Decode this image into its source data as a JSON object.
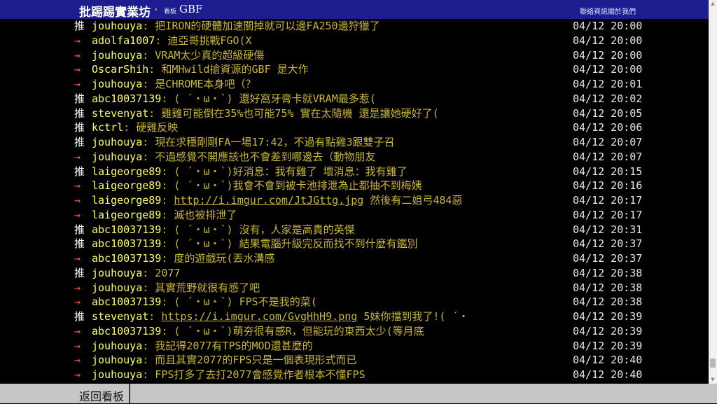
{
  "topbar": {
    "board_title": "批踢踢實業坊",
    "chevron": "›",
    "board_label": "看板",
    "board_name": "GBF",
    "links": [
      "聯絡資訊",
      "關於我們"
    ]
  },
  "comments": [
    {
      "tag": "推",
      "type": "push",
      "user": "jouhouya",
      "text": ": 把IRON的硬體加速關掉就可以邊FA250邊狩獵了",
      "time": "04/12 20:00"
    },
    {
      "tag": "→",
      "type": "arrow",
      "user": "adolfa1007",
      "text": ": 迪亞哥挑戰FGO(X",
      "time": "04/12 20:00"
    },
    {
      "tag": "→",
      "type": "arrow",
      "user": "jouhouya",
      "text": ": VRAM太少真的超級硬傷",
      "time": "04/12 20:00"
    },
    {
      "tag": "→",
      "type": "arrow",
      "user": "OscarShih",
      "text": ": 和MHwild搶資源的GBF 是大作",
      "time": "04/12 20:00"
    },
    {
      "tag": "→",
      "type": "arrow",
      "user": "jouhouya",
      "text": ": 是CHROME本身吧（？",
      "time": "04/12 20:01"
    },
    {
      "tag": "推",
      "type": "push",
      "user": "abc10037139",
      "text": ": ( ´・ω・`) 還好窩牙膏卡就VRAM最多惹(",
      "time": "04/12 20:02"
    },
    {
      "tag": "推",
      "type": "push",
      "user": "stevenyat",
      "text": ": 雞雞可能倒在35%也可能75% 實在太隨機 還是讓她硬好了(",
      "time": "04/12 20:05"
    },
    {
      "tag": "推",
      "type": "push",
      "user": "kctrl",
      "text": ": 硬雞反映",
      "time": "04/12 20:06"
    },
    {
      "tag": "推",
      "type": "push",
      "user": "jouhouya",
      "text": ": 現在求穩剛剛FA一場17:42，不過有點雞3跟雙子召",
      "time": "04/12 20:07"
    },
    {
      "tag": "→",
      "type": "arrow",
      "user": "jouhouya",
      "text": ": 不過感覺不開應該也不會差到哪邊去（動物朋友",
      "time": "04/12 20:07"
    },
    {
      "tag": "推",
      "type": "push",
      "user": "laigeorge89",
      "text": ": ( ´・ω・`)好消息：我有雞了 壞消息：我有雞了",
      "time": "04/12 20:15"
    },
    {
      "tag": "→",
      "type": "arrow",
      "user": "laigeorge89",
      "text": ": ( ´・ω・`)我會不會到被卡池排泄為止都抽不到梅姨",
      "time": "04/12 20:16"
    },
    {
      "tag": "→",
      "type": "arrow",
      "user": "laigeorge89",
      "text_prefix": ": ",
      "link": "http://i.imgur.com/JtJGttg.jpg",
      "text_suffix": " 然後有二姐弓484惡",
      "time": "04/12 20:17"
    },
    {
      "tag": "→",
      "type": "arrow",
      "user": "laigeorge89",
      "text": ": 滅也被排泄了",
      "time": "04/12 20:17"
    },
    {
      "tag": "推",
      "type": "push",
      "user": "abc10037139",
      "text": ": ( ´・ω・`) 沒有，人家是高貴的英傑",
      "time": "04/12 20:31"
    },
    {
      "tag": "推",
      "type": "push",
      "user": "abc10037139",
      "text": ": ( ´・ω・`) 結果電腦升級完反而找不到什麼有鑑別",
      "time": "04/12 20:37"
    },
    {
      "tag": "→",
      "type": "arrow",
      "user": "abc10037139",
      "text": ": 度的遊戲玩(丟水溝感",
      "time": "04/12 20:37"
    },
    {
      "tag": "推",
      "type": "push",
      "user": "jouhouya",
      "text": ": 2077",
      "time": "04/12 20:38"
    },
    {
      "tag": "→",
      "type": "arrow",
      "user": "jouhouya",
      "text": ": 其實荒野就很有感了吧",
      "time": "04/12 20:38"
    },
    {
      "tag": "→",
      "type": "arrow",
      "user": "abc10037139",
      "text": ": ( ´・ω・`) FPS不是我的菜(",
      "time": "04/12 20:38"
    },
    {
      "tag": "推",
      "type": "push",
      "user": "stevenyat",
      "text_prefix": ": ",
      "link": "https://i.imgur.com/GvgHhH9.png",
      "text_suffix": " 5妹你擋到我了!( ´・",
      "time": "04/12 20:39"
    },
    {
      "tag": "→",
      "type": "arrow",
      "user": "abc10037139",
      "text": ": ( ´・ω・`)萌夯很有感R，但能玩的東西太少(等月底",
      "time": "04/12 20:39"
    },
    {
      "tag": "→",
      "type": "arrow",
      "user": "jouhouya",
      "text": ": 我記得2077有TPS的MOD還甚麼的",
      "time": "04/12 20:39"
    },
    {
      "tag": "→",
      "type": "arrow",
      "user": "jouhouya",
      "text": ": 而且其實2077的FPS只是一個表現形式而已",
      "time": "04/12 20:40"
    },
    {
      "tag": "→",
      "type": "arrow",
      "user": "jouhouya",
      "text": ": FPS打多了去打2077會感覺作者根本不懂FPS",
      "time": "04/12 20:40"
    }
  ],
  "bottombar": {
    "back_label": "返回看板"
  },
  "colors": {
    "topbar_bg": "#1d1d8f",
    "page_bg": "#000000",
    "user": "#ffff66",
    "message": "#c9b634",
    "push_tag": "#ffffff",
    "arrow_tag": "#ff5555",
    "bottombar_bg": "#c6c6c6"
  }
}
